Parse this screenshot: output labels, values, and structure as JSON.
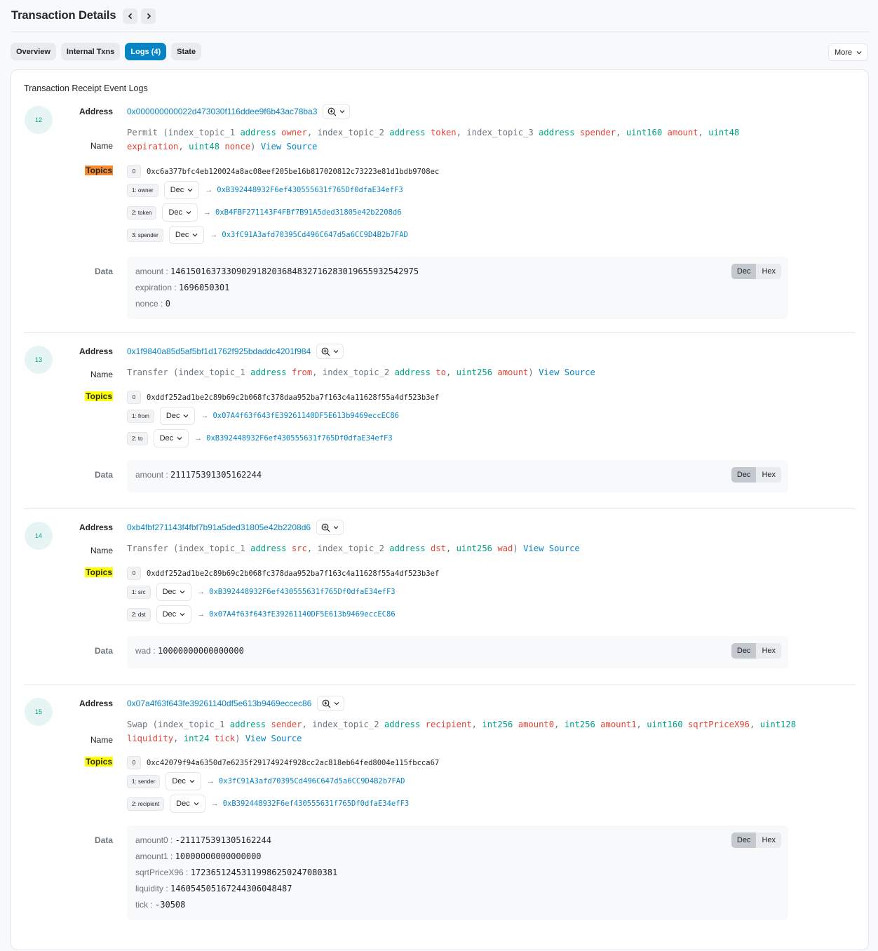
{
  "header": {
    "title": "Transaction Details",
    "prev_label": "‹",
    "next_label": "›"
  },
  "tabs": [
    {
      "label": "Overview",
      "active": false
    },
    {
      "label": "Internal Txns",
      "active": false
    },
    {
      "label": "Logs (4)",
      "active": true
    },
    {
      "label": "State",
      "active": false
    }
  ],
  "more_label": "More",
  "card_title": "Transaction Receipt Event Logs",
  "labels": {
    "address": "Address",
    "name": "Name",
    "topics": "Topics",
    "data": "Data",
    "view_source": "View Source",
    "dec": "Dec",
    "hex": "Hex"
  },
  "colors": {
    "accent": "#0784c3",
    "type": "#00a186",
    "param": "#de4437",
    "topics_highlight_first": "#f68b2d",
    "topics_highlight": "#ffff00"
  },
  "logs": [
    {
      "index": "12",
      "address": "0x000000000022d473030f116ddee9f6b43ac78ba3",
      "event": "Permit",
      "params": [
        {
          "prefix": "index_topic_1",
          "type": "address",
          "name": "owner"
        },
        {
          "prefix": "index_topic_2",
          "type": "address",
          "name": "token"
        },
        {
          "prefix": "index_topic_3",
          "type": "address",
          "name": "spender"
        },
        {
          "prefix": "",
          "type": "uint160",
          "name": "amount"
        },
        {
          "prefix": "",
          "type": "uint48",
          "name": "expiration"
        },
        {
          "prefix": "",
          "type": "uint48",
          "name": "nonce"
        }
      ],
      "topic0": "0xc6a377bfc4eb120024a8ac08eef205be16b817020812c73223e81d1bdb9708ec",
      "topics": [
        {
          "label": "1: owner",
          "format": "Dec",
          "value": "0xB392448932F6ef430555631f765Df0dfaE34efF3"
        },
        {
          "label": "2: token",
          "format": "Dec",
          "value": "0xB4FBF271143F4FBf7B91A5ded31805e42b2208d6"
        },
        {
          "label": "3: spender",
          "format": "Dec",
          "value": "0x3fC91A3afd70395Cd496C647d5a6CC9D4B2b7FAD"
        }
      ],
      "data": [
        {
          "key": "amount",
          "value": "1461501637330902918203684832716283019655932542975"
        },
        {
          "key": "expiration",
          "value": "1696050301"
        },
        {
          "key": "nonce",
          "value": "0"
        }
      ],
      "data_format": "Dec"
    },
    {
      "index": "13",
      "address": "0x1f9840a85d5af5bf1d1762f925bdaddc4201f984",
      "event": "Transfer",
      "params": [
        {
          "prefix": "index_topic_1",
          "type": "address",
          "name": "from"
        },
        {
          "prefix": "index_topic_2",
          "type": "address",
          "name": "to"
        },
        {
          "prefix": "",
          "type": "uint256",
          "name": "amount"
        }
      ],
      "topic0": "0xddf252ad1be2c89b69c2b068fc378daa952ba7f163c4a11628f55a4df523b3ef",
      "topics": [
        {
          "label": "1: from",
          "format": "Dec",
          "value": "0x07A4f63f643fE39261140DF5E613b9469eccEC86"
        },
        {
          "label": "2: to",
          "format": "Dec",
          "value": "0xB392448932F6ef430555631f765Df0dfaE34efF3"
        }
      ],
      "data": [
        {
          "key": "amount",
          "value": "211175391305162244"
        }
      ],
      "data_format": "Dec"
    },
    {
      "index": "14",
      "address": "0xb4fbf271143f4fbf7b91a5ded31805e42b2208d6",
      "event": "Transfer",
      "params": [
        {
          "prefix": "index_topic_1",
          "type": "address",
          "name": "src"
        },
        {
          "prefix": "index_topic_2",
          "type": "address",
          "name": "dst"
        },
        {
          "prefix": "",
          "type": "uint256",
          "name": "wad"
        }
      ],
      "topic0": "0xddf252ad1be2c89b69c2b068fc378daa952ba7f163c4a11628f55a4df523b3ef",
      "topics": [
        {
          "label": "1: src",
          "format": "Dec",
          "value": "0xB392448932F6ef430555631f765Df0dfaE34efF3"
        },
        {
          "label": "2: dst",
          "format": "Dec",
          "value": "0x07A4f63f643fE39261140DF5E613b9469eccEC86"
        }
      ],
      "data": [
        {
          "key": "wad",
          "value": "10000000000000000"
        }
      ],
      "data_format": "Dec"
    },
    {
      "index": "15",
      "address": "0x07a4f63f643fe39261140df5e613b9469eccec86",
      "event": "Swap",
      "params": [
        {
          "prefix": "index_topic_1",
          "type": "address",
          "name": "sender"
        },
        {
          "prefix": "index_topic_2",
          "type": "address",
          "name": "recipient"
        },
        {
          "prefix": "",
          "type": "int256",
          "name": "amount0"
        },
        {
          "prefix": "",
          "type": "int256",
          "name": "amount1"
        },
        {
          "prefix": "",
          "type": "uint160",
          "name": "sqrtPriceX96"
        },
        {
          "prefix": "",
          "type": "uint128",
          "name": "liquidity"
        },
        {
          "prefix": "",
          "type": "int24",
          "name": "tick"
        }
      ],
      "topic0": "0xc42079f94a6350d7e6235f29174924f928cc2ac818eb64fed8004e115fbcca67",
      "topics": [
        {
          "label": "1: sender",
          "format": "Dec",
          "value": "0x3fC91A3afd70395Cd496C647d5a6CC9D4B2b7FAD"
        },
        {
          "label": "2: recipient",
          "format": "Dec",
          "value": "0xB392448932F6ef430555631f765Df0dfaE34efF3"
        }
      ],
      "data": [
        {
          "key": "amount0",
          "value": "-211175391305162244"
        },
        {
          "key": "amount1",
          "value": "10000000000000000"
        },
        {
          "key": "sqrtPriceX96",
          "value": "1723651245311998625024708 0381"
        },
        {
          "key": "liquidity",
          "value": "146054505167244306048487"
        },
        {
          "key": "tick",
          "value": "-30508"
        }
      ],
      "data_format": "Dec"
    }
  ]
}
